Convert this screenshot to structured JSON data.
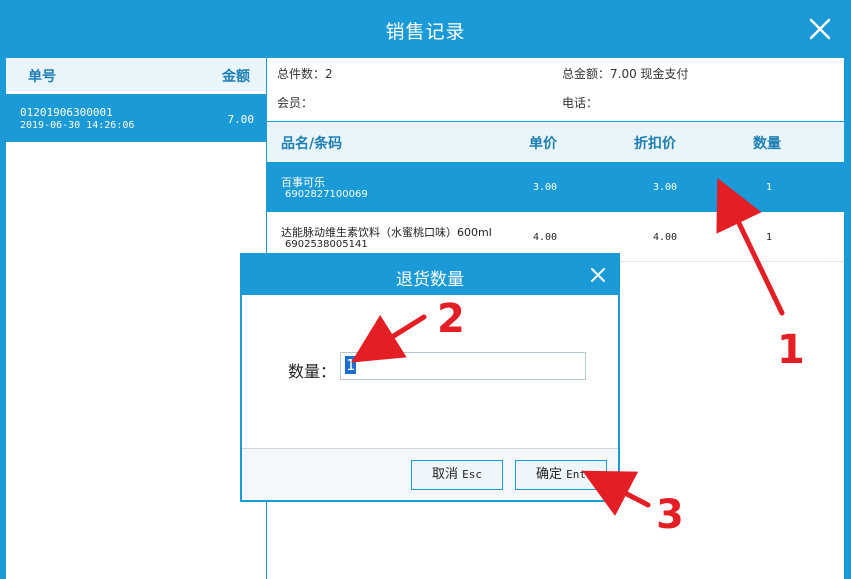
{
  "window": {
    "title": "销售记录"
  },
  "orders": {
    "col_no": "单号",
    "col_amount": "金额",
    "rows": [
      {
        "no": "01201906300001",
        "time": "2019-06-30 14:26:06",
        "amount": "7.00"
      }
    ]
  },
  "summary": {
    "total_count": "总件数：2",
    "total_amount": "总金额：7.00 现金支付",
    "member": "会员：",
    "phone": "电话："
  },
  "items": {
    "headers": [
      "品名/条码",
      "单价",
      "折扣价",
      "数量"
    ],
    "rows": [
      {
        "name": "百事可乐",
        "code": "6902827100069",
        "price": "3.00",
        "discount": "3.00",
        "qty": "1"
      },
      {
        "name": "达能脉动维生素饮料（水蜜桃口味）600ml",
        "code": "6902538005141",
        "price": "4.00",
        "discount": "4.00",
        "qty": "1"
      }
    ]
  },
  "dialog": {
    "title": "退货数量",
    "qty_label": "数量：",
    "qty_value": "1",
    "cancel_label": "取消",
    "cancel_key": "Esc",
    "confirm_label": "确定",
    "confirm_key": "Ent"
  },
  "annotations": [
    "1",
    "2",
    "3"
  ],
  "colors": {
    "accent": "#1a9ad6",
    "header_bg": "#e9f5fb",
    "annotation": "#e31e24"
  }
}
